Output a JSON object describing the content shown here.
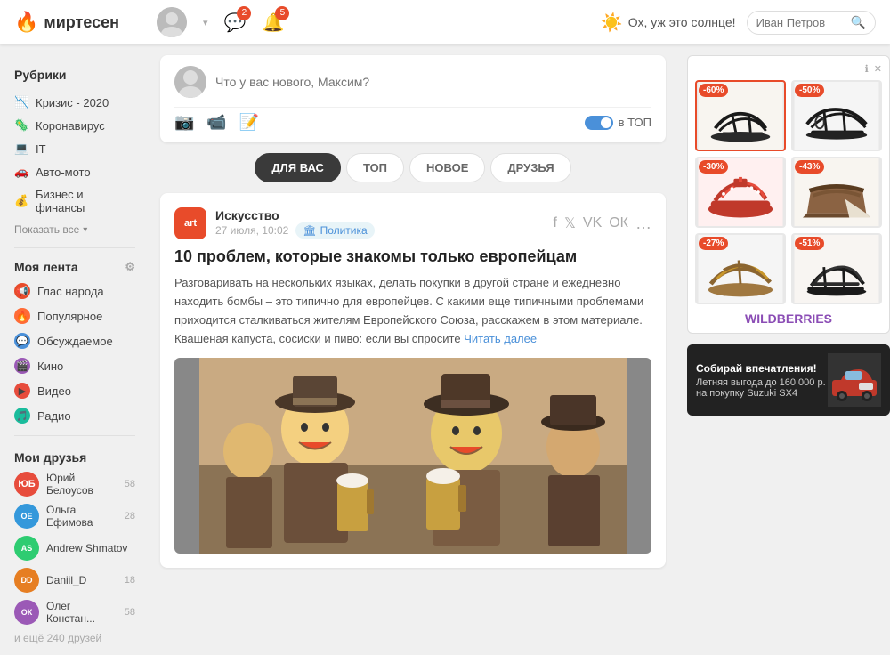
{
  "header": {
    "logo": "миртесен",
    "weather_icon": "☀️",
    "weather_text": "Ох, уж это солнце!",
    "search_placeholder": "Иван Петров",
    "notifications_count": "2",
    "bell_count": "5"
  },
  "sidebar": {
    "rubrics_title": "Рубрики",
    "rubric_items": [
      {
        "label": "Кризис - 2020",
        "icon": "📉"
      },
      {
        "label": "Коронавирус",
        "icon": "🦠"
      },
      {
        "label": "IT",
        "icon": "💻"
      },
      {
        "label": "Авто-мото",
        "icon": "🚗"
      },
      {
        "label": "Бизнес и финансы",
        "icon": "💰"
      }
    ],
    "show_all": "Показать все",
    "my_feed_title": "Моя лента",
    "feed_items": [
      {
        "label": "Глас народа",
        "icon_color": "#e84b2a",
        "icon": "📢"
      },
      {
        "label": "Популярное",
        "icon_color": "#ff6b35",
        "icon": "🔥"
      },
      {
        "label": "Обсуждаемое",
        "icon_color": "#4a90d9",
        "icon": "💬"
      },
      {
        "label": "Кино",
        "icon_color": "#9b59b6",
        "icon": "🎬"
      },
      {
        "label": "Видео",
        "icon_color": "#e74c3c",
        "icon": "▶️"
      },
      {
        "label": "Радио",
        "icon_color": "#1abc9c",
        "icon": "🎵"
      }
    ],
    "my_friends_title": "Мои друзья",
    "friends": [
      {
        "name": "Юрий Белоусов",
        "count": "58",
        "color": "#e74c3c",
        "initials": "ЮБ"
      },
      {
        "name": "Ольга Ефимова",
        "count": "28",
        "color": "#3498db",
        "initials": "ОЕ"
      },
      {
        "name": "Andrew Shmatov",
        "count": "",
        "color": "#2ecc71",
        "initials": "AS"
      },
      {
        "name": "Daniil_D",
        "count": "18",
        "color": "#e67e22",
        "initials": "DD"
      },
      {
        "name": "Олег Констан...",
        "count": "58",
        "color": "#9b59b6",
        "initials": "ОК"
      }
    ],
    "friends_more": "и ещё 240 друзей"
  },
  "post_creator": {
    "placeholder": "Что у вас нового, Максим?",
    "toggle_label": "в ТОП"
  },
  "feed_tabs": [
    {
      "label": "ДЛЯ ВАС",
      "active": true
    },
    {
      "label": "ТОП",
      "active": false
    },
    {
      "label": "НОВОЕ",
      "active": false
    },
    {
      "label": "ДРУЗЬЯ",
      "active": false
    }
  ],
  "article": {
    "channel_initials": "art",
    "channel_name": "Искусство",
    "date": "27 июля, 10:02",
    "tag": "Политика",
    "title": "10 проблем, которые знакомы только европейцам",
    "text": "Разговаривать на нескольких языках, делать покупки в другой стране и ежедневно находить бомбы – это типично для европейцев. С какими еще типичными проблемами приходится сталкиваться жителям Европейского Союза, расскажем в этом материале. Квашеная капуста, сосиски и пиво: если вы спросите",
    "read_more": "Читать далее"
  },
  "ad": {
    "info_text": "i",
    "close_text": "×",
    "items": [
      {
        "discount": "-60%",
        "selected": true
      },
      {
        "discount": "-50%",
        "selected": false
      },
      {
        "discount": "-30%",
        "selected": false
      },
      {
        "discount": "-43%",
        "selected": false
      },
      {
        "discount": "-27%",
        "selected": false
      },
      {
        "discount": "-51%",
        "selected": false
      }
    ],
    "brand": "WILDBERRIES"
  },
  "ad_banner": {
    "title": "Собирай впечатления!",
    "desc": "Летняя выгода до 160 000 р. на покупку Suzuki SX4"
  }
}
